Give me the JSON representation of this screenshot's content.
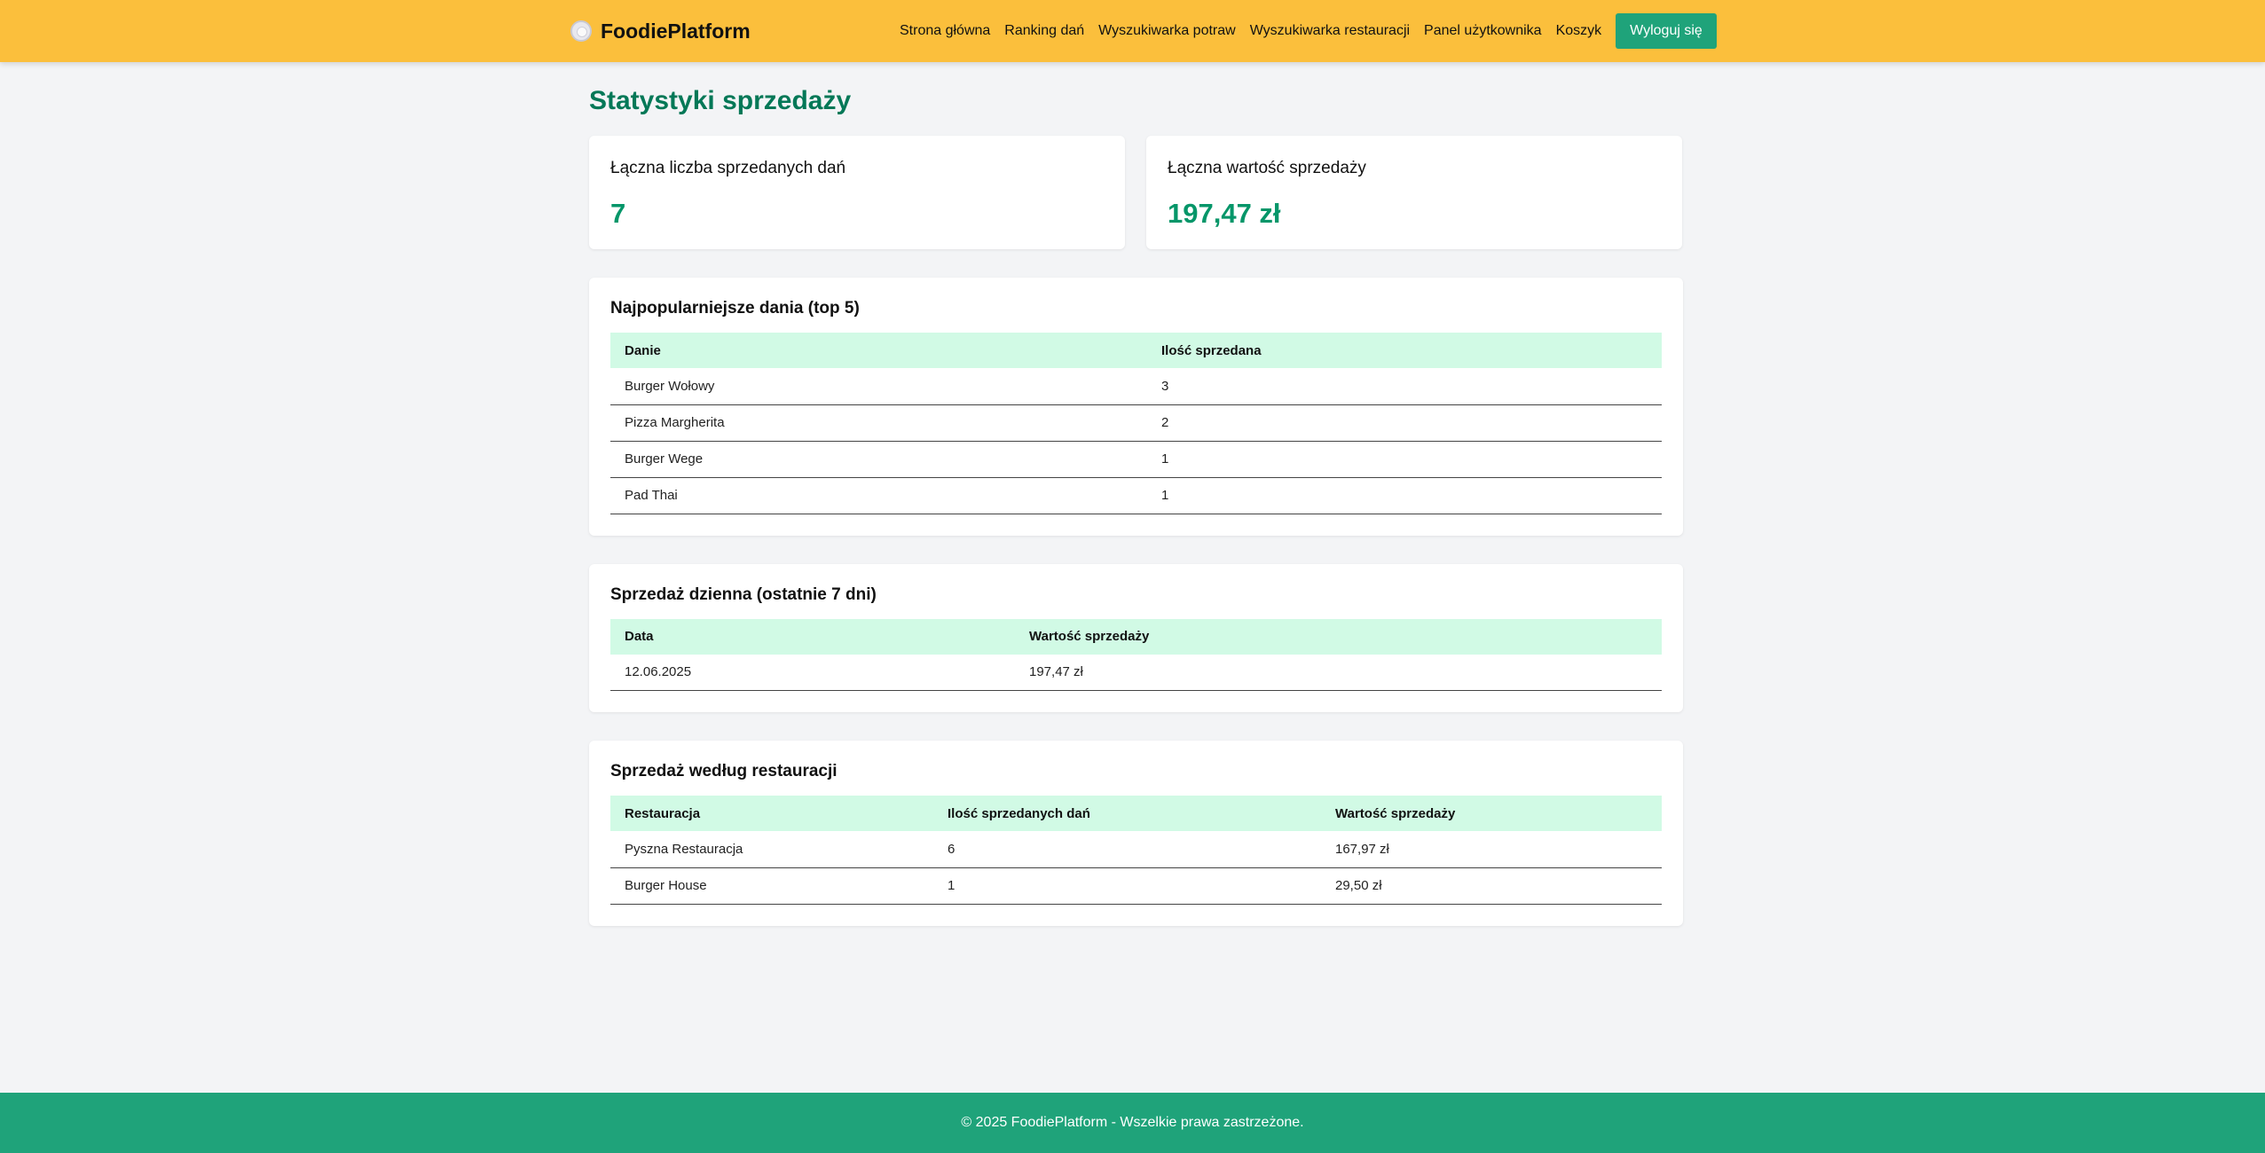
{
  "navbar": {
    "brand": "FoodiePlatform",
    "links": [
      "Strona główna",
      "Ranking dań",
      "Wyszukiwarka potraw",
      "Wyszukiwarka restauracji",
      "Panel użytkownika",
      "Koszyk"
    ],
    "logout_label": "Wyloguj się",
    "colors": {
      "background": "#fbbf3c",
      "button": "#1fa37a"
    }
  },
  "page": {
    "title": "Statystyki sprzedaży"
  },
  "stats": [
    {
      "label": "Łączna liczba sprzedanych dań",
      "value": "7"
    },
    {
      "label": "Łączna wartość sprzedaży",
      "value": "197,47 zł"
    }
  ],
  "top_dishes": {
    "title": "Najpopularniejsze dania (top 5)",
    "headers": [
      "Danie",
      "Ilość sprzedana"
    ],
    "rows": [
      [
        "Burger Wołowy",
        "3"
      ],
      [
        "Pizza Margherita",
        "2"
      ],
      [
        "Burger Wege",
        "1"
      ],
      [
        "Pad Thai",
        "1"
      ]
    ]
  },
  "daily_sales": {
    "title": "Sprzedaż dzienna (ostatnie 7 dni)",
    "headers": [
      "Data",
      "Wartość sprzedaży"
    ],
    "rows": [
      [
        "12.06.2025",
        "197,47 zł"
      ]
    ]
  },
  "restaurant_sales": {
    "title": "Sprzedaż według restauracji",
    "headers": [
      "Restauracja",
      "Ilość sprzedanych dań",
      "Wartość sprzedaży"
    ],
    "rows": [
      [
        "Pyszna Restauracja",
        "6",
        "167,97 zł"
      ],
      [
        "Burger House",
        "1",
        "29,50 zł"
      ]
    ]
  },
  "footer": {
    "text": "© 2025 FoodiePlatform - Wszelkie prawa zastrzeżone."
  }
}
